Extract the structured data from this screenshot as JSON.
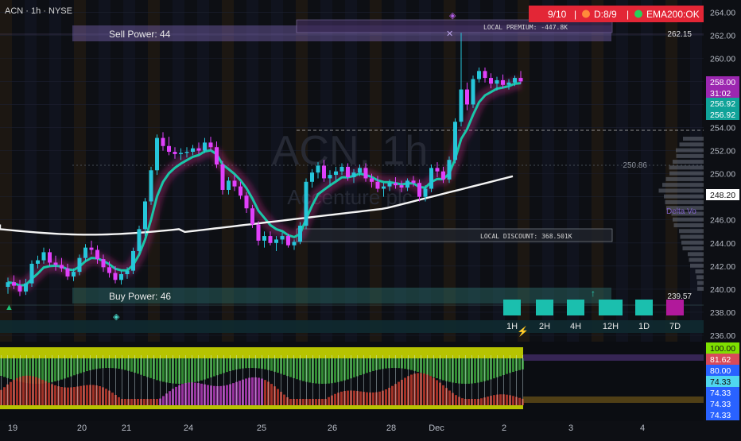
{
  "header": {
    "symbol_line": "ACN · 1h · NYSE"
  },
  "watermark": {
    "ticker": "ACN, 1h",
    "company": "Accenture plc"
  },
  "status_panel": {
    "score": "9/10",
    "direction": "D:8/9",
    "ema": "EMA200:OK",
    "sep": "|"
  },
  "labels": {
    "sell_power": "Sell Power: 44",
    "buy_power": "Buy Power: 46",
    "local_premium": "LOCAL PREMIUM: -447.8K",
    "local_discount": "LOCAL DISCOUNT: 368.501K",
    "delta_vol": "Delta Vo",
    "premium_level": "262.15",
    "discount_level": "239.57",
    "mid_level": "250.86"
  },
  "timeframes": [
    "1H",
    "2H",
    "4H",
    "12H",
    "1D",
    "7D"
  ],
  "price_badges": [
    {
      "text": "258.00",
      "bg": "#9c27b0",
      "fg": "#ffffff"
    },
    {
      "text": "31:02",
      "bg": "#9c27b0",
      "fg": "#ffffff"
    },
    {
      "text": "256.92",
      "bg": "#10a399",
      "fg": "#ffffff"
    },
    {
      "text": "256.92",
      "bg": "#10a399",
      "fg": "#ffffff"
    },
    {
      "text": "248.20",
      "bg": "#ffffff",
      "fg": "#111111"
    }
  ],
  "osc_badges": [
    {
      "text": "100.00",
      "bg": "#7ee000",
      "fg": "#111111"
    },
    {
      "text": "81.62",
      "bg": "#d84a5a",
      "fg": "#ffffff"
    },
    {
      "text": "80.00",
      "bg": "#2962ff",
      "fg": "#ffffff"
    },
    {
      "text": "74.33",
      "bg": "#4fd6ef",
      "fg": "#111111"
    },
    {
      "text": "74.33",
      "bg": "#2962ff",
      "fg": "#ffffff"
    },
    {
      "text": "74.33",
      "bg": "#2962ff",
      "fg": "#ffffff"
    },
    {
      "text": "74.33",
      "bg": "#2962ff",
      "fg": "#ffffff"
    }
  ],
  "chart_data": {
    "type": "candlestick",
    "timeframe": "1h",
    "y_range": [
      236,
      264.5
    ],
    "y_ticks": [
      236,
      238,
      240,
      242,
      244,
      246,
      248,
      250,
      252,
      254,
      256,
      258,
      260,
      262,
      264
    ],
    "x_labels": [
      "19",
      "20",
      "21",
      "24",
      "25",
      "26",
      "28",
      "Dec",
      "2",
      "3",
      "4"
    ],
    "candles": [
      [
        240.2,
        241.0,
        239.6,
        240.6
      ],
      [
        240.6,
        241.2,
        240.0,
        240.3
      ],
      [
        240.3,
        240.8,
        239.4,
        239.8
      ],
      [
        239.8,
        240.9,
        239.5,
        240.5
      ],
      [
        240.5,
        242.5,
        240.2,
        242.2
      ],
      [
        242.2,
        242.9,
        241.8,
        242.5
      ],
      [
        242.5,
        243.6,
        242.2,
        243.2
      ],
      [
        243.2,
        243.5,
        242.0,
        242.3
      ],
      [
        242.3,
        242.9,
        241.6,
        242.1
      ],
      [
        242.1,
        242.7,
        241.5,
        241.8
      ],
      [
        241.8,
        242.2,
        240.8,
        241.1
      ],
      [
        241.1,
        241.8,
        240.7,
        241.5
      ],
      [
        241.5,
        243.0,
        241.2,
        242.7
      ],
      [
        242.7,
        243.9,
        242.4,
        243.6
      ],
      [
        243.6,
        244.2,
        243.0,
        243.4
      ],
      [
        243.4,
        243.8,
        242.2,
        242.6
      ],
      [
        242.6,
        243.0,
        241.5,
        241.9
      ],
      [
        241.9,
        242.4,
        241.0,
        241.4
      ],
      [
        241.4,
        242.0,
        240.5,
        240.8
      ],
      [
        240.8,
        241.6,
        240.4,
        241.3
      ],
      [
        241.3,
        241.9,
        240.9,
        241.6
      ],
      [
        241.6,
        243.6,
        241.3,
        243.3
      ],
      [
        243.3,
        245.5,
        243.0,
        245.2
      ],
      [
        245.2,
        247.9,
        244.6,
        247.6
      ],
      [
        247.6,
        250.6,
        247.3,
        250.3
      ],
      [
        250.3,
        253.4,
        249.9,
        253.1
      ],
      [
        253.1,
        253.6,
        252.0,
        252.4
      ],
      [
        252.4,
        253.2,
        251.6,
        251.9
      ],
      [
        251.9,
        252.3,
        251.3,
        251.7
      ],
      [
        251.7,
        252.2,
        251.2,
        251.8
      ],
      [
        251.8,
        252.3,
        251.4,
        251.9
      ],
      [
        251.9,
        252.5,
        251.6,
        252.2
      ],
      [
        252.2,
        252.7,
        251.7,
        252.0
      ],
      [
        252.0,
        253.1,
        251.8,
        252.7
      ],
      [
        252.7,
        253.2,
        252.0,
        252.3
      ],
      [
        252.3,
        252.8,
        250.5,
        250.8
      ],
      [
        250.8,
        251.1,
        248.2,
        248.6
      ],
      [
        248.6,
        249.7,
        248.2,
        249.4
      ],
      [
        249.4,
        249.9,
        248.5,
        248.9
      ],
      [
        248.9,
        249.3,
        247.8,
        248.1
      ],
      [
        248.1,
        248.4,
        246.6,
        247.0
      ],
      [
        247.0,
        247.3,
        245.3,
        245.6
      ],
      [
        245.6,
        245.9,
        243.8,
        244.2
      ],
      [
        244.2,
        245.0,
        243.6,
        244.6
      ],
      [
        244.6,
        245.0,
        243.8,
        244.0
      ],
      [
        244.0,
        244.6,
        243.3,
        244.3
      ],
      [
        244.3,
        244.9,
        243.9,
        244.6
      ],
      [
        244.6,
        244.8,
        243.6,
        243.8
      ],
      [
        243.8,
        244.3,
        243.4,
        244.1
      ],
      [
        244.1,
        245.8,
        243.9,
        245.5
      ],
      [
        245.5,
        249.6,
        245.2,
        249.3
      ],
      [
        249.3,
        250.4,
        248.8,
        250.1
      ],
      [
        250.1,
        251.0,
        249.6,
        250.7
      ],
      [
        250.7,
        251.2,
        249.3,
        249.6
      ],
      [
        249.6,
        250.3,
        249.0,
        249.9
      ],
      [
        249.9,
        250.6,
        249.4,
        250.2
      ],
      [
        250.2,
        250.9,
        249.9,
        250.6
      ],
      [
        250.6,
        250.9,
        249.4,
        249.7
      ],
      [
        249.7,
        250.4,
        249.2,
        250.1
      ],
      [
        250.1,
        250.8,
        249.8,
        250.5
      ],
      [
        250.5,
        250.9,
        249.3,
        249.6
      ],
      [
        249.6,
        250.0,
        248.8,
        249.3
      ],
      [
        249.3,
        249.8,
        248.4,
        248.7
      ],
      [
        248.7,
        249.2,
        248.0,
        248.9
      ],
      [
        248.9,
        249.5,
        248.5,
        249.2
      ],
      [
        249.2,
        249.7,
        248.7,
        249.0
      ],
      [
        249.0,
        249.4,
        248.4,
        248.8
      ],
      [
        248.8,
        249.6,
        248.5,
        249.4
      ],
      [
        249.4,
        249.8,
        248.9,
        249.2
      ],
      [
        249.2,
        249.5,
        247.6,
        248.0
      ],
      [
        248.0,
        249.0,
        247.6,
        248.7
      ],
      [
        248.7,
        250.8,
        248.4,
        250.5
      ],
      [
        250.5,
        251.0,
        249.7,
        250.2
      ],
      [
        250.2,
        250.6,
        249.2,
        249.5
      ],
      [
        249.5,
        251.5,
        249.2,
        251.2
      ],
      [
        251.2,
        254.8,
        250.9,
        254.5
      ],
      [
        254.5,
        262.2,
        254.1,
        257.3
      ],
      [
        257.3,
        257.9,
        255.5,
        256.0
      ],
      [
        256.0,
        258.5,
        255.7,
        258.2
      ],
      [
        258.2,
        259.2,
        257.9,
        258.9
      ],
      [
        258.9,
        259.2,
        257.9,
        258.3
      ],
      [
        258.3,
        258.7,
        257.4,
        257.8
      ],
      [
        257.8,
        258.4,
        257.2,
        258.1
      ],
      [
        258.1,
        258.6,
        257.4,
        257.7
      ],
      [
        257.7,
        258.2,
        257.3,
        257.9
      ],
      [
        257.9,
        258.5,
        257.6,
        258.3
      ],
      [
        258.3,
        258.9,
        257.8,
        258.0
      ]
    ]
  }
}
